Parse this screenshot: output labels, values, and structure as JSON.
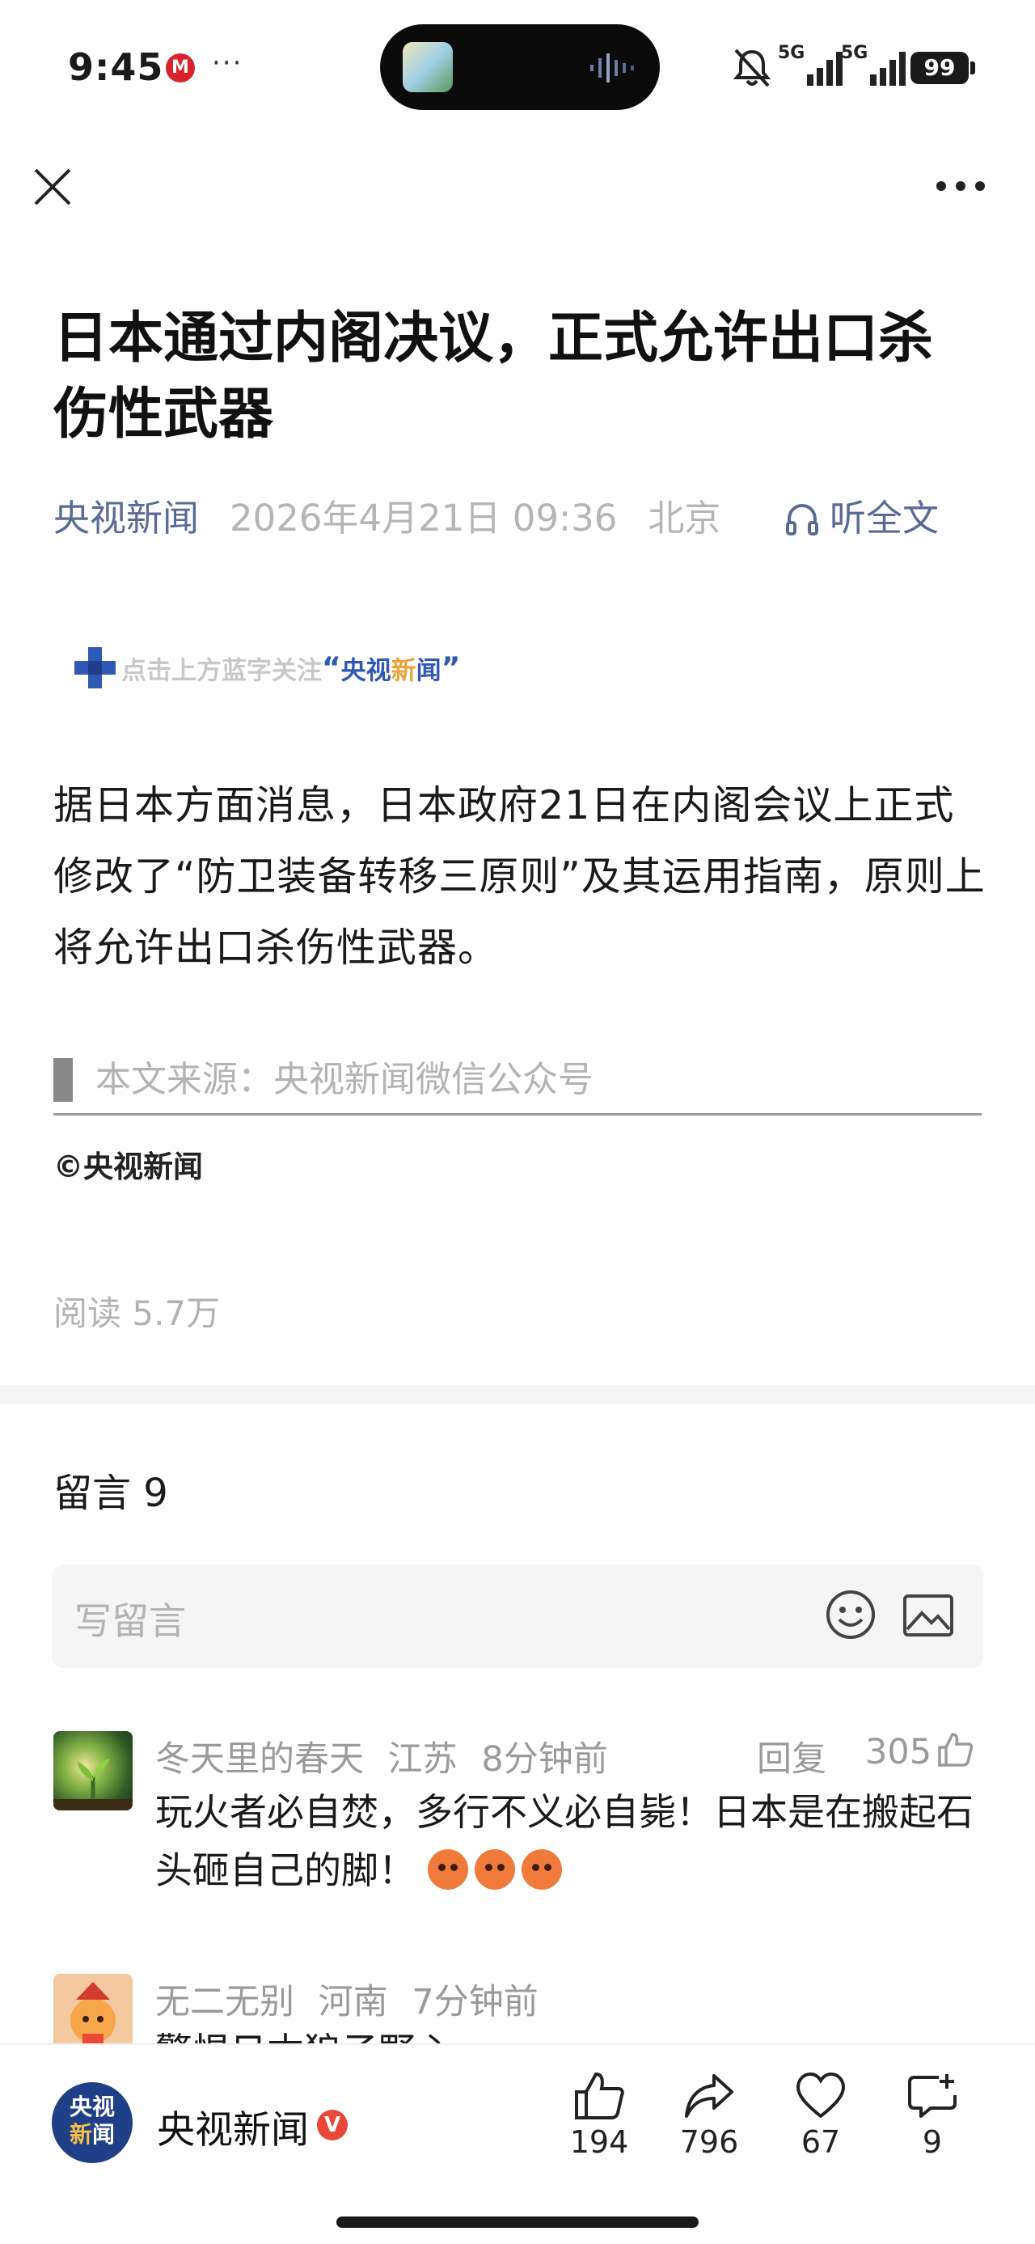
{
  "status_bar": {
    "time": "9:45",
    "carrier_icon": "M",
    "dots": "···",
    "network1": "5G",
    "network2": "5G",
    "battery": "99"
  },
  "nav": {
    "close_icon": "close-icon",
    "more_icon": "more-icon"
  },
  "article": {
    "title": "日本通过内阁决议，正式允许出口杀伤性武器",
    "author": "央视新闻",
    "date": "2026年4月21日 09:36",
    "location": "北京",
    "listen_label": "听全文",
    "follow_prefix": "点击上方蓝字关注",
    "follow_brand_a": "央视",
    "follow_brand_b": "新",
    "follow_brand_c": "闻",
    "body": "据日本方面消息，日本政府21日在内阁会议上正式修改了“防卫装备转移三原则”及其运用指南，原则上将允许出口杀伤性武器。",
    "source": "本文来源：央视新闻微信公众号",
    "copyright": "©央视新闻",
    "reads": "阅读 5.7万"
  },
  "comments": {
    "title": "留言 9",
    "input_placeholder": "写留言",
    "items": [
      {
        "name": "冬天里的春天",
        "region": "江苏",
        "time": "8分钟前",
        "reply_label": "回复",
        "likes": "305",
        "text": "玩火者必自焚，多行不义必自毙！日本是在搬起石头砸自己的脚！"
      },
      {
        "name": "无二无别",
        "region": "河南",
        "time": "7分钟前",
        "text": "警惕日本狼子野心"
      }
    ]
  },
  "bottom_bar": {
    "logo_line1": "央视",
    "logo_line2a": "新",
    "logo_line2b": "闻",
    "account_name": "央视新闻",
    "verified": "V",
    "actions": [
      {
        "icon": "thumbs-up-icon",
        "count": "194"
      },
      {
        "icon": "share-icon",
        "count": "796"
      },
      {
        "icon": "heart-icon",
        "count": "67"
      },
      {
        "icon": "comment-icon",
        "count": "9"
      }
    ]
  }
}
